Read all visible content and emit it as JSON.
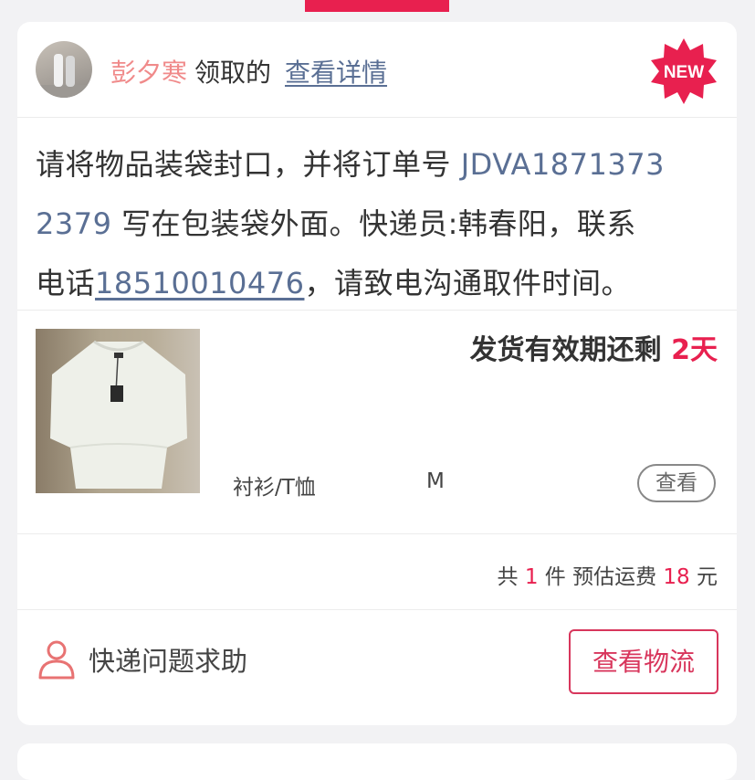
{
  "header": {
    "username": "彭夕寒",
    "claimed_text": "领取的",
    "detail_link": "查看详情",
    "badge": "NEW"
  },
  "instruction": {
    "part1": "请将物品装袋封口，并将订单号 ",
    "order_no_line1": "JDVA1871373",
    "order_no_line2": "2379",
    "part2": " 写在包装袋外面。快递员:韩春阳，联系",
    "part3": "电话",
    "phone": "18510010476",
    "part4": "，请致电沟通取件时间。"
  },
  "product": {
    "deadline_label": "发货有效期还剩 ",
    "deadline_days": "2天",
    "category": "衬衫/T恤",
    "size": "M",
    "view_label": "查看"
  },
  "summary": {
    "prefix": "共 ",
    "count": "1",
    "middle": " 件 预估运费 ",
    "fee": "18",
    "suffix": " 元"
  },
  "footer": {
    "help_label": "快递问题求助",
    "logistics_label": "查看物流"
  },
  "colors": {
    "accent": "#e8204f",
    "link": "#5a6f94",
    "username": "#f08a8a",
    "button_border": "#d8365c"
  },
  "icons": {
    "help": "person-outline-icon",
    "badge": "new-starburst-icon"
  }
}
